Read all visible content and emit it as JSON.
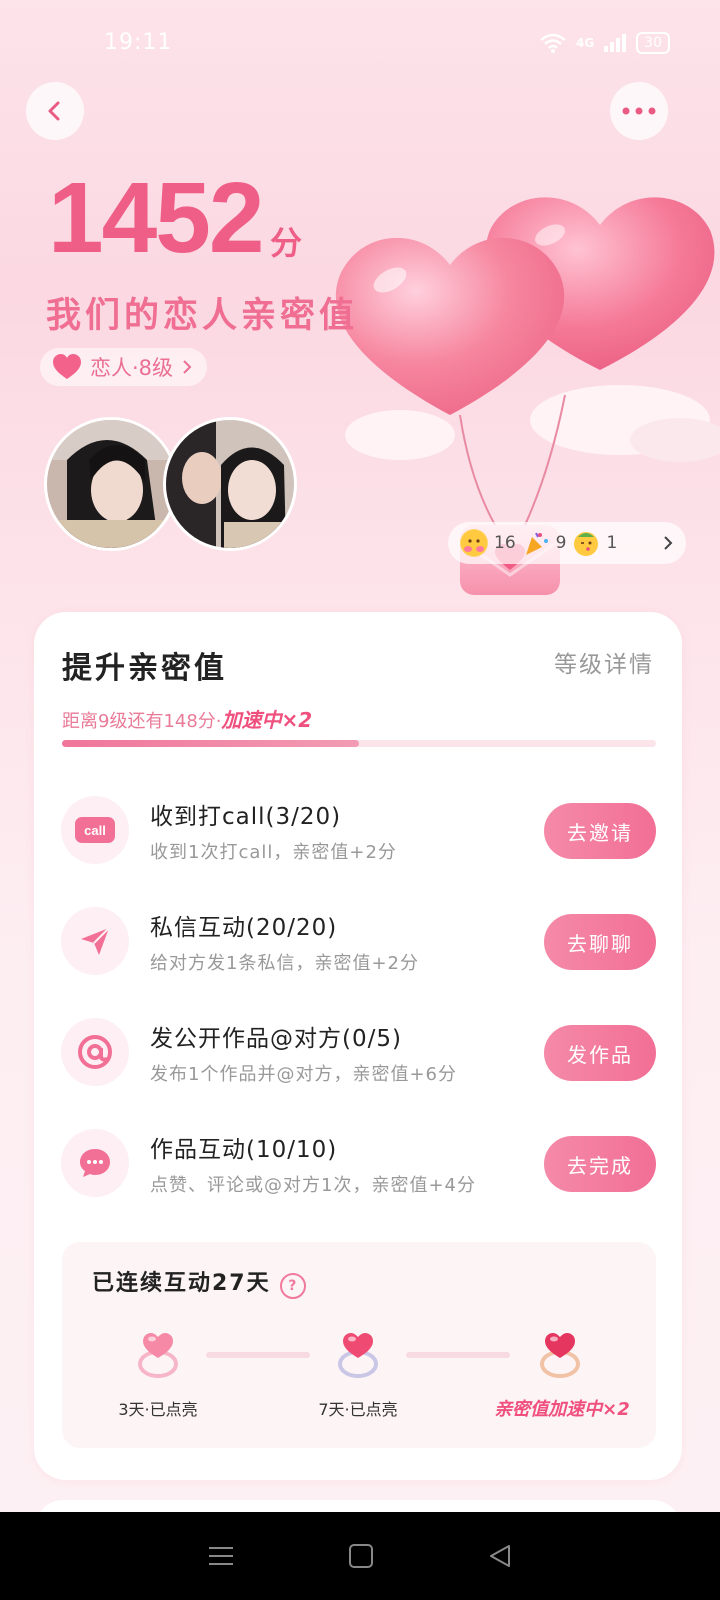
{
  "status": {
    "time": "19:11",
    "network": "4G",
    "battery": "30"
  },
  "header": {
    "back_icon": "chevron-left-icon",
    "more_icon": "more-dots-icon"
  },
  "score": {
    "value": "1452",
    "unit": "分",
    "title": "我们的恋人亲密值"
  },
  "level": {
    "label": "恋人·8级"
  },
  "stats": [
    {
      "icon": "hug-emoji-icon",
      "count": "16"
    },
    {
      "icon": "party-popper-emoji-icon",
      "count": "9"
    },
    {
      "icon": "kiss-emoji-icon",
      "count": "1"
    }
  ],
  "card": {
    "title": "提升亲密值",
    "link": "等级详情",
    "progress_text": "距离9级还有148分·",
    "progress_boost": "加速中×2",
    "progress_fraction": 0.5
  },
  "tasks": [
    {
      "icon": "call-icon",
      "title": "收到打call(3/20)",
      "desc": "收到1次打call，亲密值+2分",
      "button": "去邀请"
    },
    {
      "icon": "send-message-icon",
      "title": "私信互动(20/20)",
      "desc": "给对方发1条私信，亲密值+2分",
      "button": "去聊聊"
    },
    {
      "icon": "at-sign-icon",
      "title": "发公开作品@对方(0/5)",
      "desc": "发布1个作品并@对方，亲密值+6分",
      "button": "发作品"
    },
    {
      "icon": "chat-bubble-icon",
      "title": "作品互动(10/10)",
      "desc": "点赞、评论或@对方1次，亲密值+4分",
      "button": "去完成"
    }
  ],
  "streak": {
    "title": "已连续互动27天",
    "milestones": [
      {
        "icon": "heart-ring-pink-icon",
        "label": "3天·已点亮"
      },
      {
        "icon": "heart-ring-silver-icon",
        "label": "7天·已点亮"
      },
      {
        "icon": "heart-ring-gold-icon",
        "label": "亲密值加速中×2"
      }
    ]
  },
  "colors": {
    "accent": "#f0507d",
    "button": "#f26f95",
    "background": "#fde3ea"
  }
}
